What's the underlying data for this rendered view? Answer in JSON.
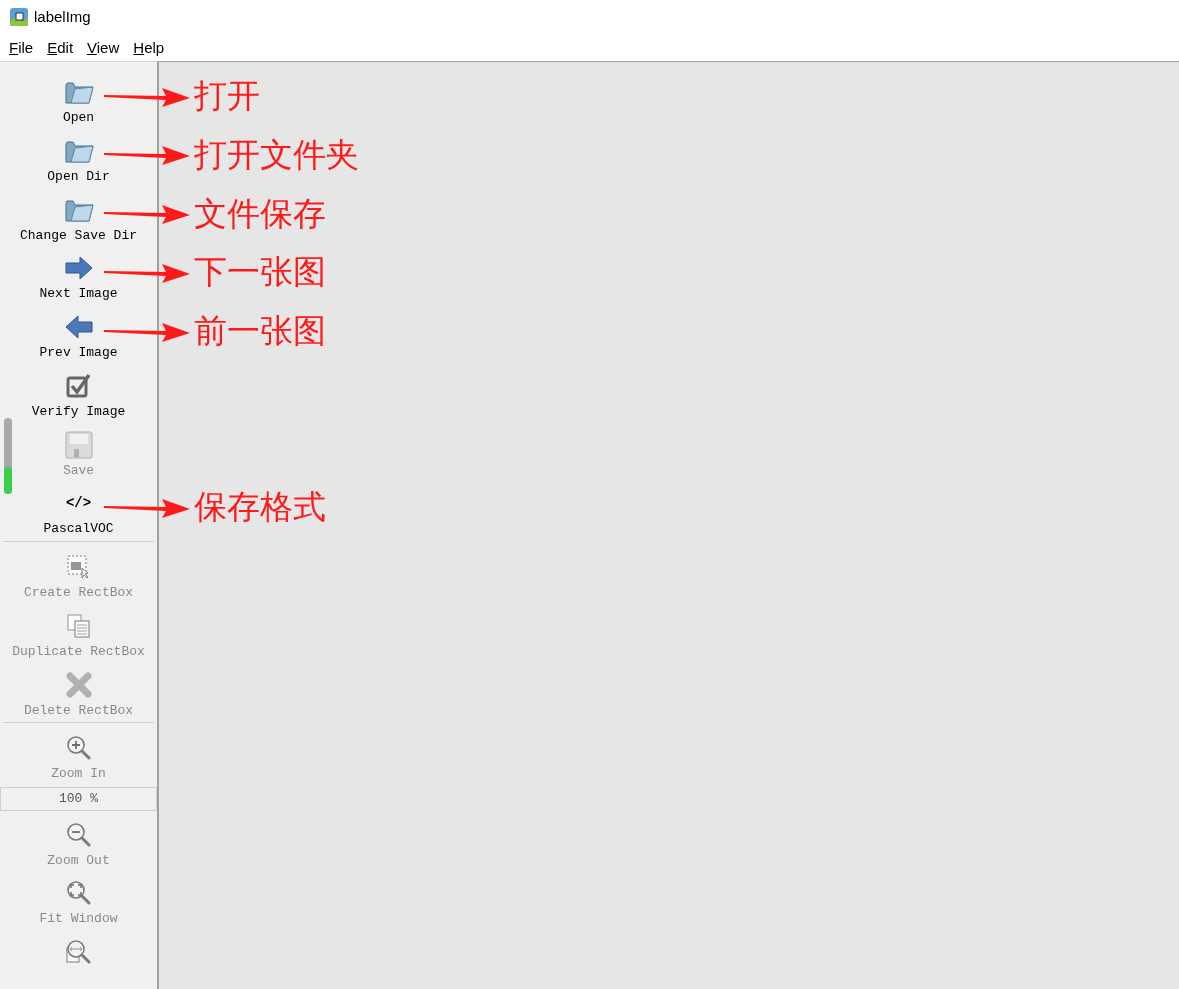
{
  "window": {
    "title": "labelImg"
  },
  "menu": [
    "File",
    "Edit",
    "View",
    "Help"
  ],
  "toolbar": [
    {
      "kind": "tool",
      "label": "Open",
      "disabled": false,
      "annotation": "打开"
    },
    {
      "kind": "tool",
      "label": "Open Dir",
      "disabled": false,
      "annotation": "打开文件夹"
    },
    {
      "kind": "tool",
      "label": "Change Save Dir",
      "disabled": false,
      "annotation": "文件保存"
    },
    {
      "kind": "tool",
      "label": "Next Image",
      "disabled": false,
      "annotation": "下一张图"
    },
    {
      "kind": "tool",
      "label": "Prev Image",
      "disabled": false,
      "annotation": "前一张图"
    },
    {
      "kind": "tool",
      "label": "Verify Image",
      "disabled": false
    },
    {
      "kind": "tool",
      "label": "Save",
      "disabled": true
    },
    {
      "kind": "tool",
      "glyph": "</>",
      "label": "PascalVOC",
      "disabled": false,
      "annotation": "保存格式"
    },
    {
      "kind": "separator"
    },
    {
      "kind": "tool",
      "label": "Create RectBox",
      "disabled": true
    },
    {
      "kind": "tool",
      "label": "Duplicate RectBox",
      "disabled": true
    },
    {
      "kind": "tool",
      "label": "Delete RectBox",
      "disabled": true
    },
    {
      "kind": "separator"
    },
    {
      "kind": "tool",
      "label": "Zoom In",
      "disabled": true
    },
    {
      "kind": "zoom-value",
      "label": "100 %"
    },
    {
      "kind": "tool",
      "label": "Zoom Out",
      "disabled": true
    },
    {
      "kind": "tool",
      "label": "Fit Window",
      "disabled": true
    },
    {
      "kind": "tool",
      "disabled": true
    }
  ]
}
